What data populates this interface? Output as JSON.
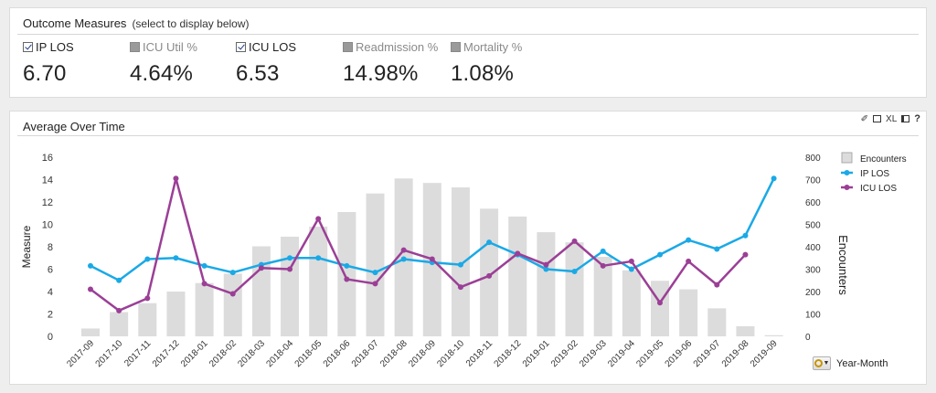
{
  "measures_panel": {
    "title": "Outcome Measures",
    "subtitle": "(select to display below)",
    "items": [
      {
        "label": "IP LOS",
        "value": "6.70",
        "checked": true
      },
      {
        "label": "ICU Util %",
        "value": "4.64%",
        "checked": false
      },
      {
        "label": "ICU LOS",
        "value": "6.53",
        "checked": true
      },
      {
        "label": "Readmission %",
        "value": "14.98%",
        "checked": false
      },
      {
        "label": "Mortality %",
        "value": "1.08%",
        "checked": false
      }
    ]
  },
  "chart_panel": {
    "title": "Average Over Time",
    "toolbar": {
      "pin_icon": "pin-icon",
      "print_icon": "print-icon",
      "export_label": "XL",
      "layout_icon": "layout-icon",
      "help_label": "?"
    },
    "dimension_control": {
      "label": "Year-Month",
      "icon": "cycle-dimension-icon"
    }
  },
  "chart_data": {
    "type": "bar",
    "title": "",
    "xlabel": "",
    "ylabel": "Measure",
    "y2label": "Encounters",
    "ylim": [
      0,
      16
    ],
    "y2lim": [
      0,
      800
    ],
    "yticks": [
      0,
      2,
      4,
      6,
      8,
      10,
      12,
      14,
      16
    ],
    "y2ticks": [
      0,
      100,
      200,
      300,
      400,
      500,
      600,
      700,
      800
    ],
    "legend_position": "right",
    "grid": false,
    "categories": [
      "2017-09",
      "2017-10",
      "2017-11",
      "2017-12",
      "2018-01",
      "2018-02",
      "2018-03",
      "2018-04",
      "2018-05",
      "2018-06",
      "2018-07",
      "2018-08",
      "2018-09",
      "2018-10",
      "2018-11",
      "2018-12",
      "2019-01",
      "2019-02",
      "2019-03",
      "2019-04",
      "2019-05",
      "2019-06",
      "2019-07",
      "2019-08",
      "2019-09"
    ],
    "series": [
      {
        "name": "Encounters",
        "type": "bar",
        "axis": "right",
        "color": "#dcdcdc",
        "values": [
          35,
          108,
          148,
          200,
          238,
          280,
          402,
          445,
          490,
          555,
          638,
          705,
          685,
          665,
          570,
          535,
          465,
          420,
          355,
          295,
          248,
          210,
          125,
          45,
          5
        ]
      },
      {
        "name": "IP LOS",
        "type": "line",
        "axis": "left",
        "color": "#1aa9e6",
        "values": [
          6.3,
          5.0,
          6.9,
          7.0,
          6.3,
          5.7,
          6.4,
          7.0,
          7.0,
          6.3,
          5.7,
          6.9,
          6.6,
          6.4,
          8.4,
          7.3,
          6.0,
          5.8,
          7.6,
          6.0,
          7.3,
          8.6,
          7.8,
          9.0,
          14.1
        ]
      },
      {
        "name": "ICU LOS",
        "type": "line",
        "axis": "left",
        "color": "#9b3f96",
        "values": [
          4.2,
          2.3,
          3.4,
          14.1,
          4.7,
          3.8,
          6.1,
          6.0,
          10.5,
          5.1,
          4.7,
          7.7,
          6.9,
          4.4,
          5.4,
          7.4,
          6.4,
          8.5,
          6.3,
          6.7,
          3.0,
          6.7,
          4.6,
          7.3,
          null
        ]
      }
    ]
  }
}
